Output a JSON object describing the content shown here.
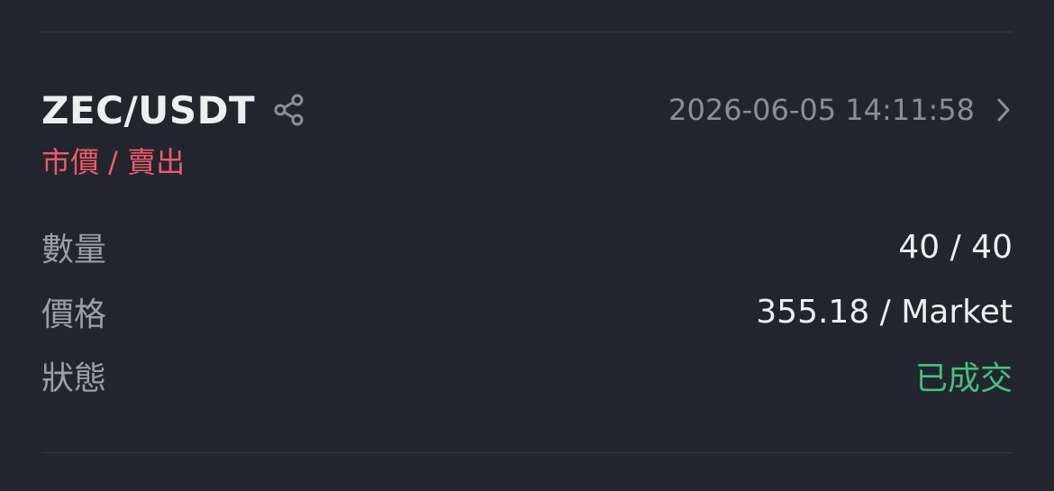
{
  "order": {
    "pair": "ZEC/USDT",
    "timestamp": "2026-06-05 14:11:58",
    "side_label": "市價 / 賣出",
    "rows": [
      {
        "label": "數量",
        "value": "40 / 40"
      },
      {
        "label": "價格",
        "value": "355.18 / Market"
      },
      {
        "label": "狀態",
        "value": "已成交"
      }
    ]
  },
  "icons": {
    "share": "share-icon",
    "detail": "chevron-right-icon"
  },
  "colors": {
    "background": "#22252e",
    "divider": "#34373f",
    "primary_text": "#eceef2",
    "secondary_text": "#9a9ea8",
    "sell_red": "#ef5a68",
    "filled_green": "#45c07e"
  }
}
